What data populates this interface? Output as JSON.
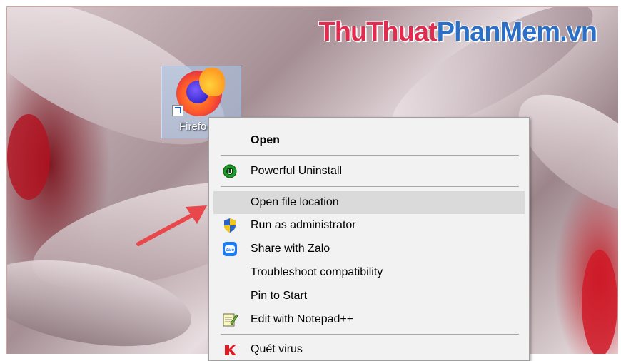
{
  "watermark": {
    "part1": "ThuThuat",
    "part2": "PhanMem.vn"
  },
  "desktop_icon": {
    "label": "Firefo",
    "icon": "firefox-icon"
  },
  "menu": {
    "items": [
      {
        "label": "Open",
        "icon": ""
      },
      {
        "label": "Powerful Uninstall",
        "icon": "powerful-uninstall-icon"
      },
      {
        "label": "Open file location",
        "icon": ""
      },
      {
        "label": "Run as administrator",
        "icon": "uac-shield-icon"
      },
      {
        "label": "Share with Zalo",
        "icon": "zalo-icon"
      },
      {
        "label": "Troubleshoot compatibility",
        "icon": ""
      },
      {
        "label": "Pin to Start",
        "icon": ""
      },
      {
        "label": "Edit with Notepad++",
        "icon": "notepad-plus-plus-icon"
      },
      {
        "label": "Quét virus",
        "icon": "kaspersky-icon"
      }
    ]
  },
  "colors": {
    "accent_red": "#e12c4f",
    "accent_blue": "#2c6fc7",
    "menu_bg": "#f2f2f2",
    "highlight": "#dadada",
    "arrow": "#e8474c"
  }
}
